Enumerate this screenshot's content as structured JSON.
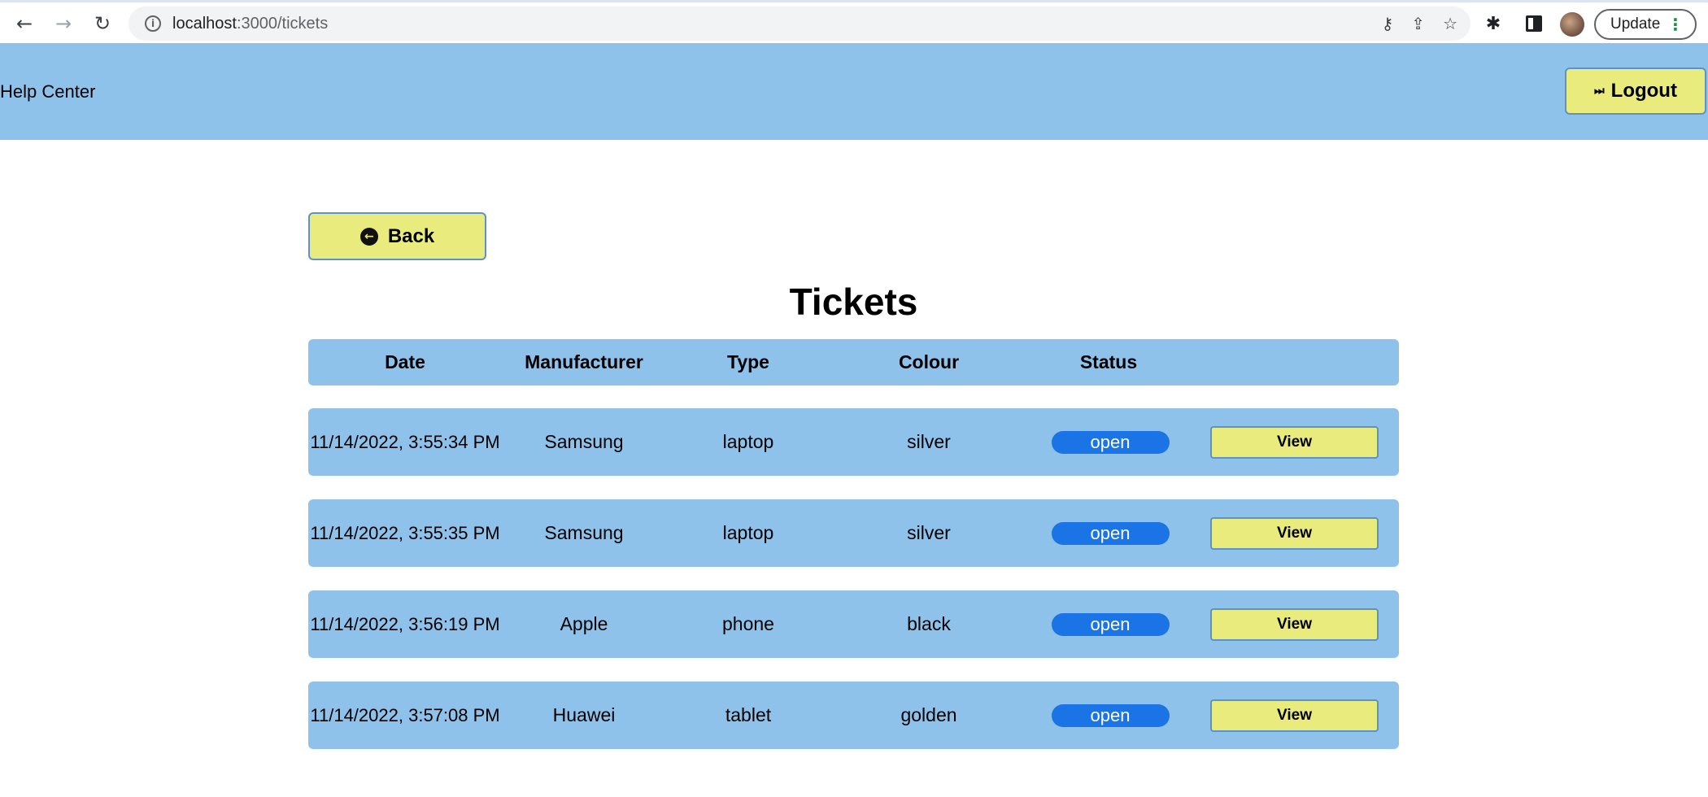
{
  "browser": {
    "url_host": "localhost",
    "url_path": ":3000/tickets",
    "update_label": "Update",
    "update_menu_glyph": "⋮"
  },
  "header": {
    "brand": "Help Center",
    "logout_label": "Logout",
    "logout_icon": "⏭"
  },
  "main": {
    "back_label": "Back",
    "title": "Tickets",
    "columns": [
      "Date",
      "Manufacturer",
      "Type",
      "Colour",
      "Status"
    ],
    "rows": [
      {
        "date": "11/14/2022, 3:55:34 PM",
        "manufacturer": "Samsung",
        "type": "laptop",
        "colour": "silver",
        "status": "open",
        "action": "View"
      },
      {
        "date": "11/14/2022, 3:55:35 PM",
        "manufacturer": "Samsung",
        "type": "laptop",
        "colour": "silver",
        "status": "open",
        "action": "View"
      },
      {
        "date": "11/14/2022, 3:56:19 PM",
        "manufacturer": "Apple",
        "type": "phone",
        "colour": "black",
        "status": "open",
        "action": "View"
      },
      {
        "date": "11/14/2022, 3:57:08 PM",
        "manufacturer": "Huawei",
        "type": "tablet",
        "colour": "golden",
        "status": "open",
        "action": "View"
      }
    ]
  },
  "colors": {
    "header_bg": "#8fc2ea",
    "button_bg": "#e9ec7c",
    "status_open": "#1a74e6"
  }
}
